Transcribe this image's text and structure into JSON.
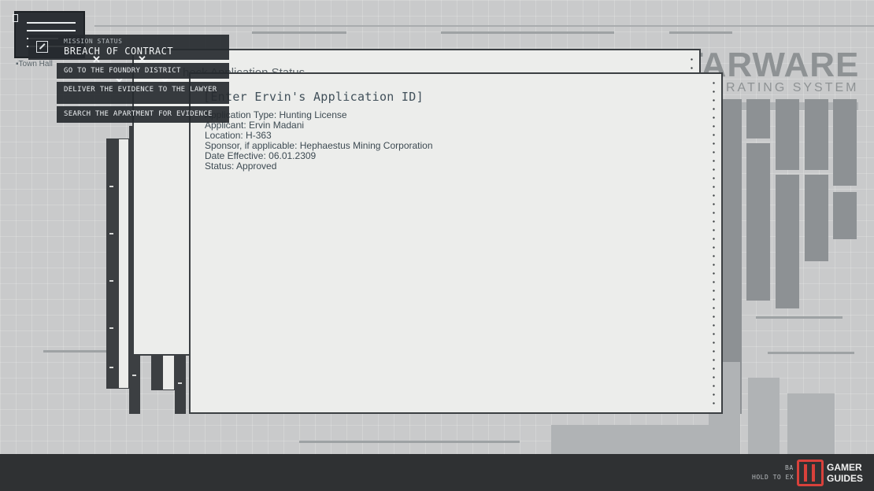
{
  "brand": {
    "name": "STARWARE",
    "name_visible": "TARWARE",
    "subtitle_visible": "RATING SYSTEM"
  },
  "back_window": {
    "title_visible": "heck Application Status"
  },
  "terminal": {
    "prompt": "[Enter Ervin's Application ID]",
    "details": [
      "Application Type: Hunting License",
      "Applicant: Ervin Madani",
      "Location: H-363",
      "Sponsor, if applicable: Hephaestus Mining Corporation",
      "Date Effective: 06.01.2309",
      "Status: Approved"
    ]
  },
  "mission": {
    "label": "MISSION STATUS",
    "title": "BREACH OF CONTRACT",
    "objectives": [
      "GO TO THE FOUNDRY DISTRICT",
      "DELIVER THE EVIDENCE TO THE LAWYER",
      "SEARCH THE APARTMENT FOR EVIDENCE"
    ],
    "location_label": "Town Hall"
  },
  "hints": {
    "back": "BA",
    "hold_exit": "HOLD TO EX"
  },
  "watermark": {
    "line1": "GAMER",
    "line2": "GUIDES"
  },
  "colors": {
    "window_bg": "#ecedeb",
    "window_border": "#3b3f42",
    "panel_bg": "#262a2f",
    "logo_red": "#d8413b"
  }
}
